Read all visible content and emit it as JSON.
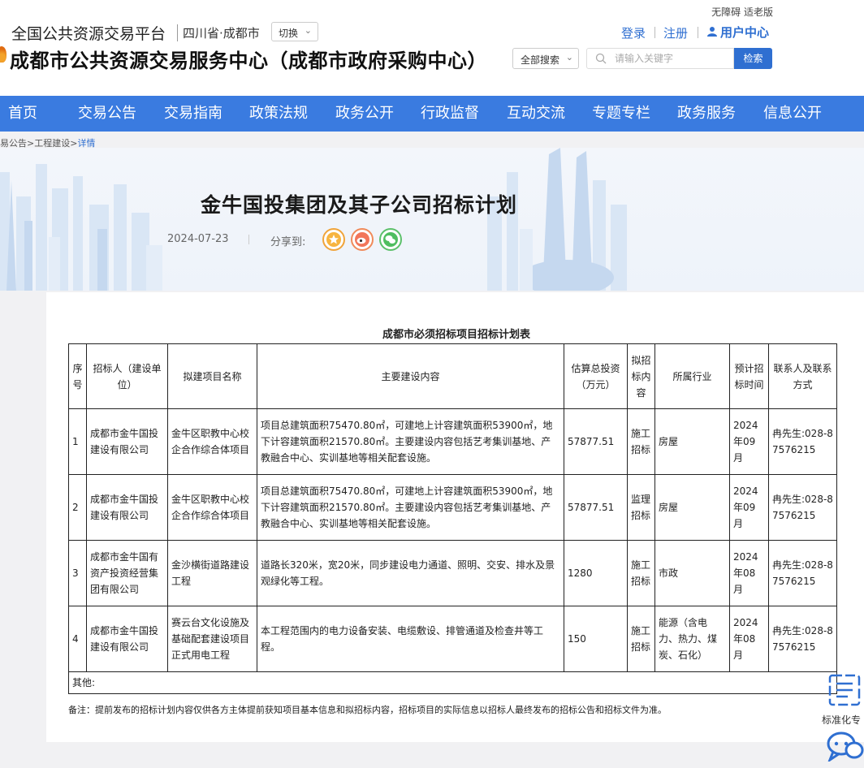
{
  "header": {
    "accessibility": "无障碍 适老版",
    "platform_name": "全国公共资源交易平台",
    "region": "四川省·成都市",
    "switch_label": "切换",
    "login": "登录",
    "register": "注册",
    "user_center": "用户中心",
    "center_title": "成都市公共资源交易服务中心（成都市政府采购中心）",
    "search_scope": "全部搜索",
    "search_placeholder": "请输入关键字",
    "search_button": "检索"
  },
  "nav": [
    "首页",
    "交易公告",
    "交易指南",
    "政策法规",
    "政务公开",
    "行政监督",
    "互动交流",
    "专题专栏",
    "政务服务",
    "信息公开"
  ],
  "breadcrumb": {
    "path": "易公告>工程建设>",
    "current": "详情"
  },
  "article": {
    "title": "金牛国投集团及其子公司招标计划",
    "date": "2024-07-23",
    "share_label": "分享到:"
  },
  "table": {
    "title": "成都市必须招标项目招标计划表",
    "headers": [
      "序号",
      "招标人（建设单位）",
      "拟建项目名称",
      "主要建设内容",
      "估算总投资（万元）",
      "拟招标内容",
      "所属行业",
      "预计招标时间",
      "联系人及联系方式"
    ],
    "rows": [
      [
        "1",
        "成都市金牛国投建设有限公司",
        "金牛区职教中心校企合作综合体项目",
        "项目总建筑面积75470.80㎡，可建地上计容建筑面积53900㎡，地下计容建筑面积21570.80㎡。主要建设内容包括艺考集训基地、产教融合中心、实训基地等相关配套设施。",
        "57877.51",
        "施工招标",
        "房屋",
        "2024年09月",
        "冉先生:028-87576215"
      ],
      [
        "2",
        "成都市金牛国投建设有限公司",
        "金牛区职教中心校企合作综合体项目",
        "项目总建筑面积75470.80㎡，可建地上计容建筑面积53900㎡，地下计容建筑面积21570.80㎡。主要建设内容包括艺考集训基地、产教融合中心、实训基地等相关配套设施。",
        "57877.51",
        "监理招标",
        "房屋",
        "2024年09月",
        "冉先生:028-87576215"
      ],
      [
        "3",
        "成都市金牛国有资产投资经营集团有限公司",
        "金沙横街道路建设工程",
        "道路长320米，宽20米，同步建设电力通道、照明、交安、排水及景观绿化等工程。",
        "1280",
        "施工招标",
        "市政",
        "2024年08月",
        "冉先生:028-87576215"
      ],
      [
        "4",
        "成都市金牛国投建设有限公司",
        "赛云台文化设施及基础配套建设项目正式用电工程",
        "本工程范围内的电力设备安装、电缆敷设、排管通道及检查井等工程。",
        "150",
        "施工招标",
        "能源（含电力、热力、煤炭、石化）",
        "2024年08月",
        "冉先生:028-87576215"
      ]
    ],
    "other_label": "其他:",
    "remark": "备注：提前发布的招标计划内容仅供各方主体提前获知项目基本信息和拟招标内容，招标项目的实际信息以招标人最终发布的招标公告和招标文件为准。"
  },
  "widgets": {
    "standard_label": "标准化专"
  },
  "colors": {
    "brand_blue": "#3a7be0",
    "link_blue": "#2f6fd1"
  }
}
